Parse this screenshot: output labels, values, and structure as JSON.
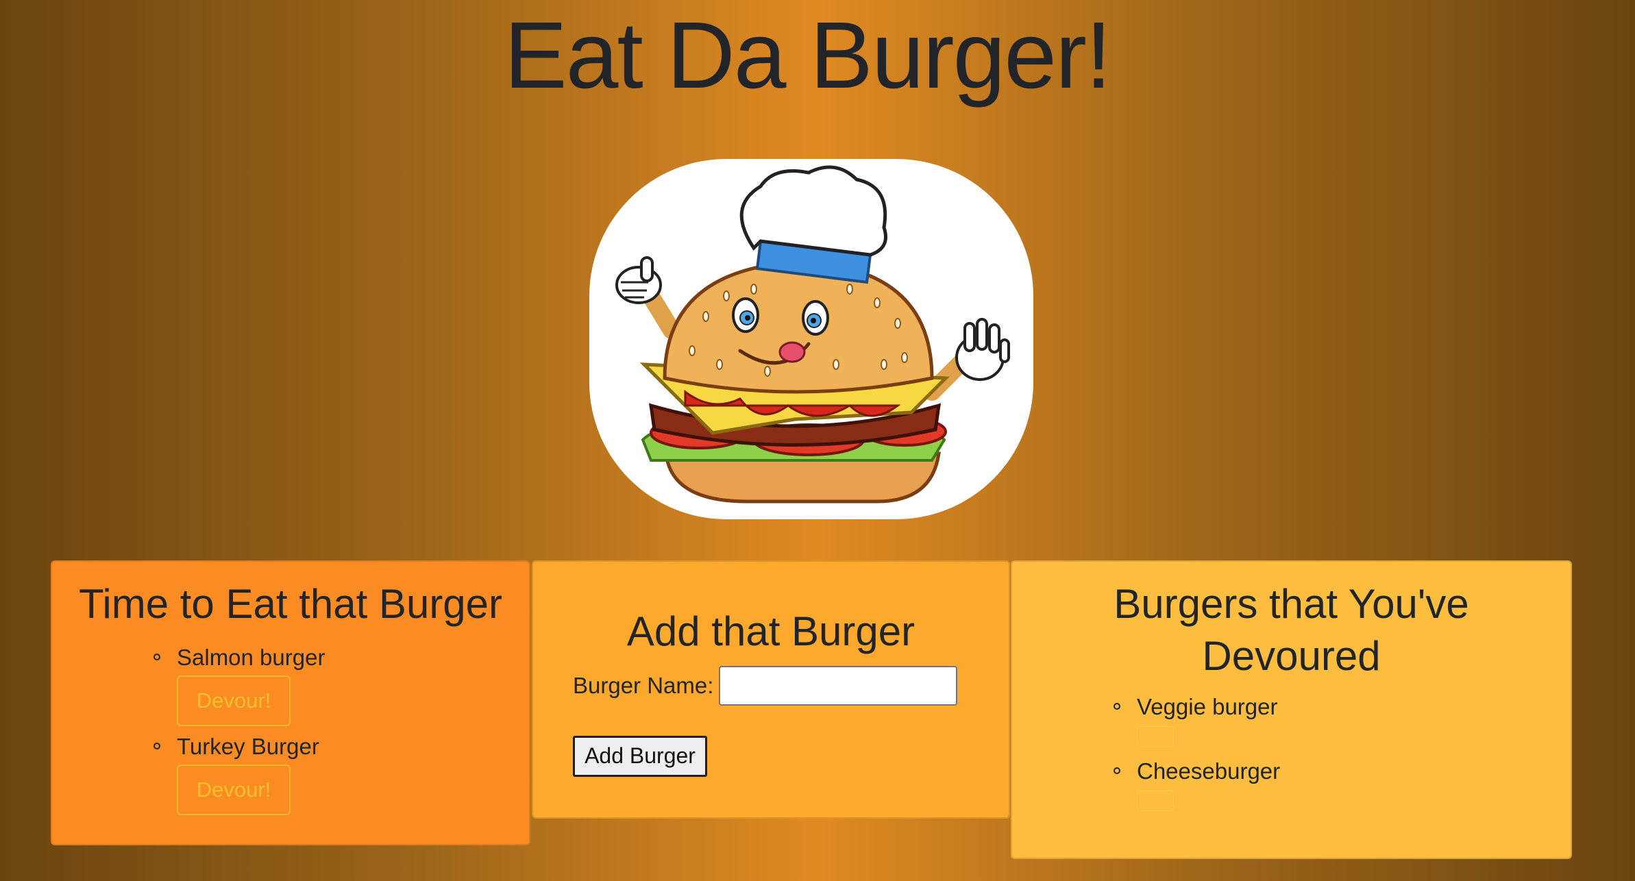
{
  "page": {
    "title": "Eat Da Burger!"
  },
  "logo": {
    "icon": "chef-burger-mascot-icon"
  },
  "to_eat": {
    "heading": "Time to Eat that Burger",
    "items": [
      {
        "name": "Salmon burger",
        "button": "Devour!"
      },
      {
        "name": "Turkey Burger",
        "button": "Devour!"
      }
    ]
  },
  "add_form": {
    "heading": "Add that Burger",
    "label": "Burger Name:",
    "input_value": "",
    "input_placeholder": "",
    "submit_label": "Add Burger"
  },
  "devoured": {
    "heading": "Burgers that You've Devoured",
    "items": [
      {
        "name": "Veggie burger"
      },
      {
        "name": "Cheeseburger"
      }
    ]
  },
  "colors": {
    "card_to_eat": "#fb8c24",
    "card_add": "#fca92d",
    "card_devoured": "#fdbd3f",
    "devour_button_text": "#f5c02c"
  }
}
